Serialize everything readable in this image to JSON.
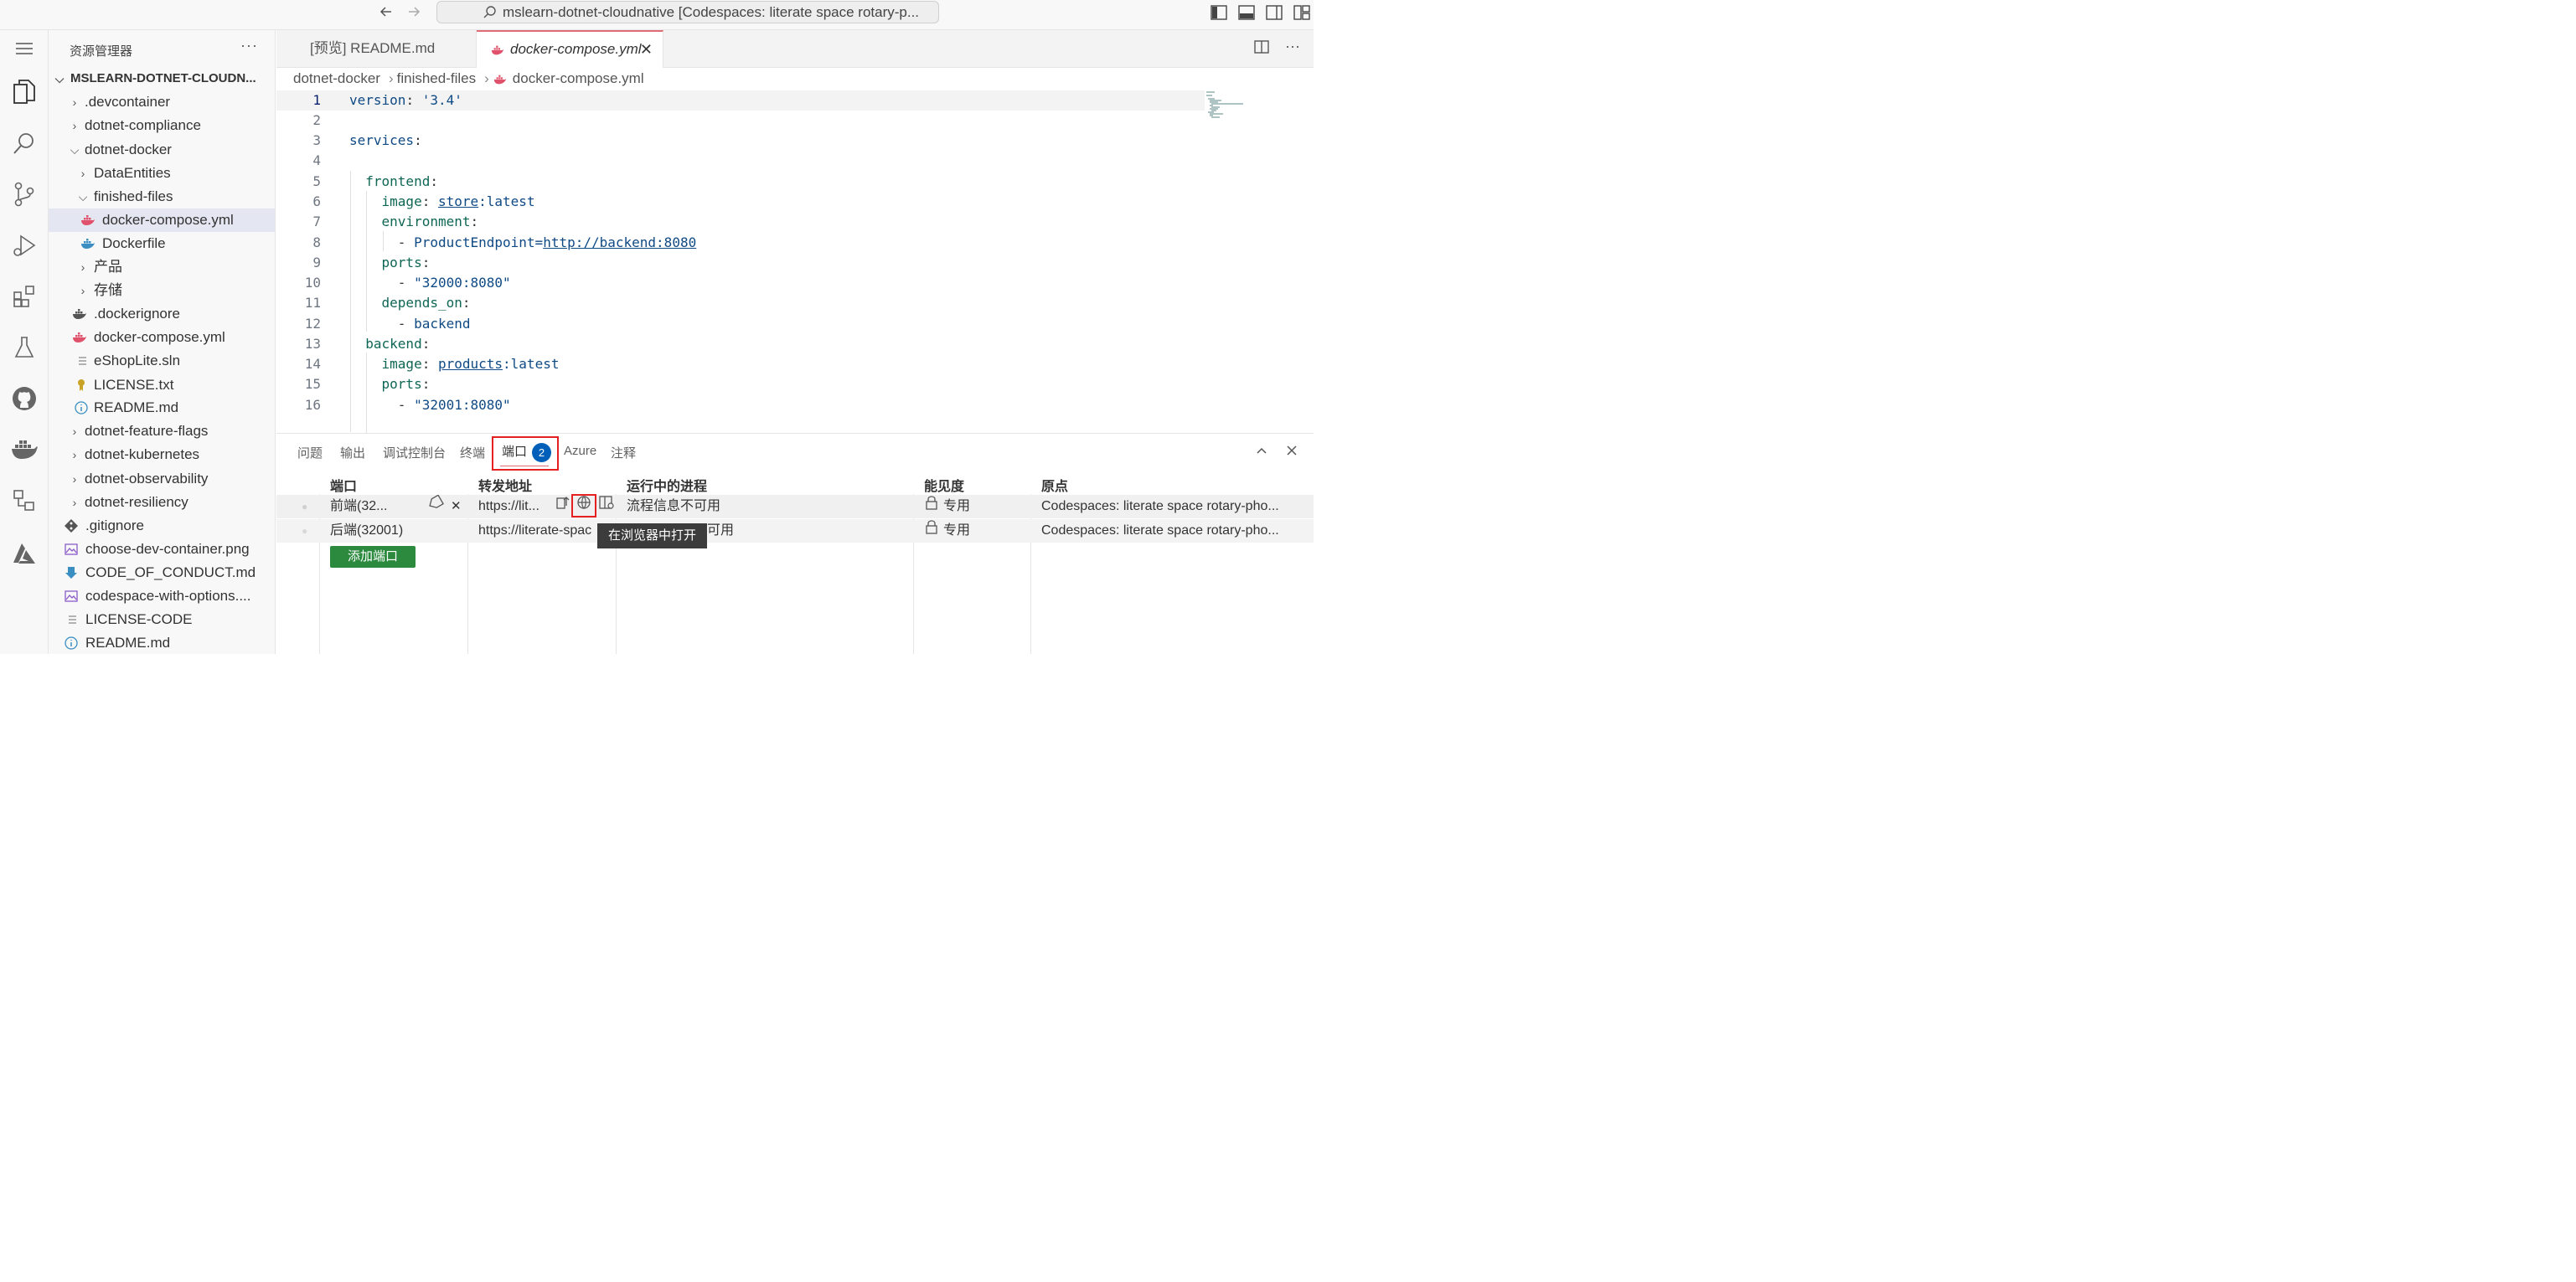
{
  "titlebar": {
    "search_text": "mslearn-dotnet-cloudnative [Codespaces: literate space rotary-p..."
  },
  "sidebar": {
    "header": "资源管理器",
    "root": "MSLEARN-DOTNET-CLOUDN...",
    "items": [
      {
        "label": ".devcontainer"
      },
      {
        "label": "dotnet-compliance"
      },
      {
        "label": "dotnet-docker"
      },
      {
        "label": "DataEntities"
      },
      {
        "label": "finished-files"
      },
      {
        "label": "docker-compose.yml"
      },
      {
        "label": "Dockerfile"
      },
      {
        "label": "产品"
      },
      {
        "label": "存储"
      },
      {
        "label": ".dockerignore"
      },
      {
        "label": "docker-compose.yml"
      },
      {
        "label": "eShopLite.sln"
      },
      {
        "label": "LICENSE.txt"
      },
      {
        "label": "README.md"
      },
      {
        "label": "dotnet-feature-flags"
      },
      {
        "label": "dotnet-kubernetes"
      },
      {
        "label": "dotnet-observability"
      },
      {
        "label": "dotnet-resiliency"
      },
      {
        "label": ".gitignore"
      },
      {
        "label": "choose-dev-container.png"
      },
      {
        "label": "CODE_OF_CONDUCT.md"
      },
      {
        "label": "codespace-with-options...."
      },
      {
        "label": "LICENSE-CODE"
      },
      {
        "label": "README.md"
      }
    ]
  },
  "tabs": [
    {
      "label": "[预览] README.md"
    },
    {
      "label": "docker-compose.yml"
    }
  ],
  "breadcrumb": [
    "dotnet-docker",
    "finished-files",
    "docker-compose.yml"
  ],
  "code": {
    "lines": [
      {
        "n": "1"
      },
      {
        "n": "2"
      },
      {
        "n": "3"
      },
      {
        "n": "4"
      },
      {
        "n": "5"
      },
      {
        "n": "6"
      },
      {
        "n": "7"
      },
      {
        "n": "8"
      },
      {
        "n": "9"
      },
      {
        "n": "10"
      },
      {
        "n": "11"
      },
      {
        "n": "12"
      },
      {
        "n": "13"
      },
      {
        "n": "14"
      },
      {
        "n": "15"
      },
      {
        "n": "16"
      }
    ],
    "text": {
      "l1_key": "version",
      "l1_val": "'3.4'",
      "l3_key": "services",
      "l5_key": "frontend",
      "l6_key": "image",
      "l6_val_a": "store",
      "l6_val_b": ":latest",
      "l7_key": "environment",
      "l8_dash": "- ",
      "l8_a": "ProductEndpoint=",
      "l8_b": "http://backend:8080",
      "l9_key": "ports",
      "l10_val": "\"32000:8080\"",
      "l11_key": "depends_on",
      "l12_val": "backend",
      "l13_key": "backend",
      "l14_key": "image",
      "l14_val_a": "products",
      "l14_val_b": ":latest",
      "l15_key": "ports",
      "l16_val": "\"32001:8080\""
    }
  },
  "panel": {
    "tabs": [
      "问题",
      "输出",
      "调试控制台",
      "终端",
      "端口",
      "Azure",
      "注释"
    ],
    "ports_badge": "2",
    "columns": [
      "端口",
      "转发地址",
      "运行中的进程",
      "能见度",
      "原点"
    ],
    "rows": [
      {
        "port": "前端(32...",
        "address": "https://lit...",
        "process": "流程信息不可用",
        "visibility": "专用",
        "origin": "Codespaces: literate space rotary-pho..."
      },
      {
        "port": "后端(32001)",
        "address": "https://literate-spac",
        "process": "可用",
        "visibility": "专用",
        "origin": "Codespaces: literate space rotary-pho..."
      }
    ],
    "add_port": "添加端口",
    "tooltip": "在浏览器中打开"
  }
}
